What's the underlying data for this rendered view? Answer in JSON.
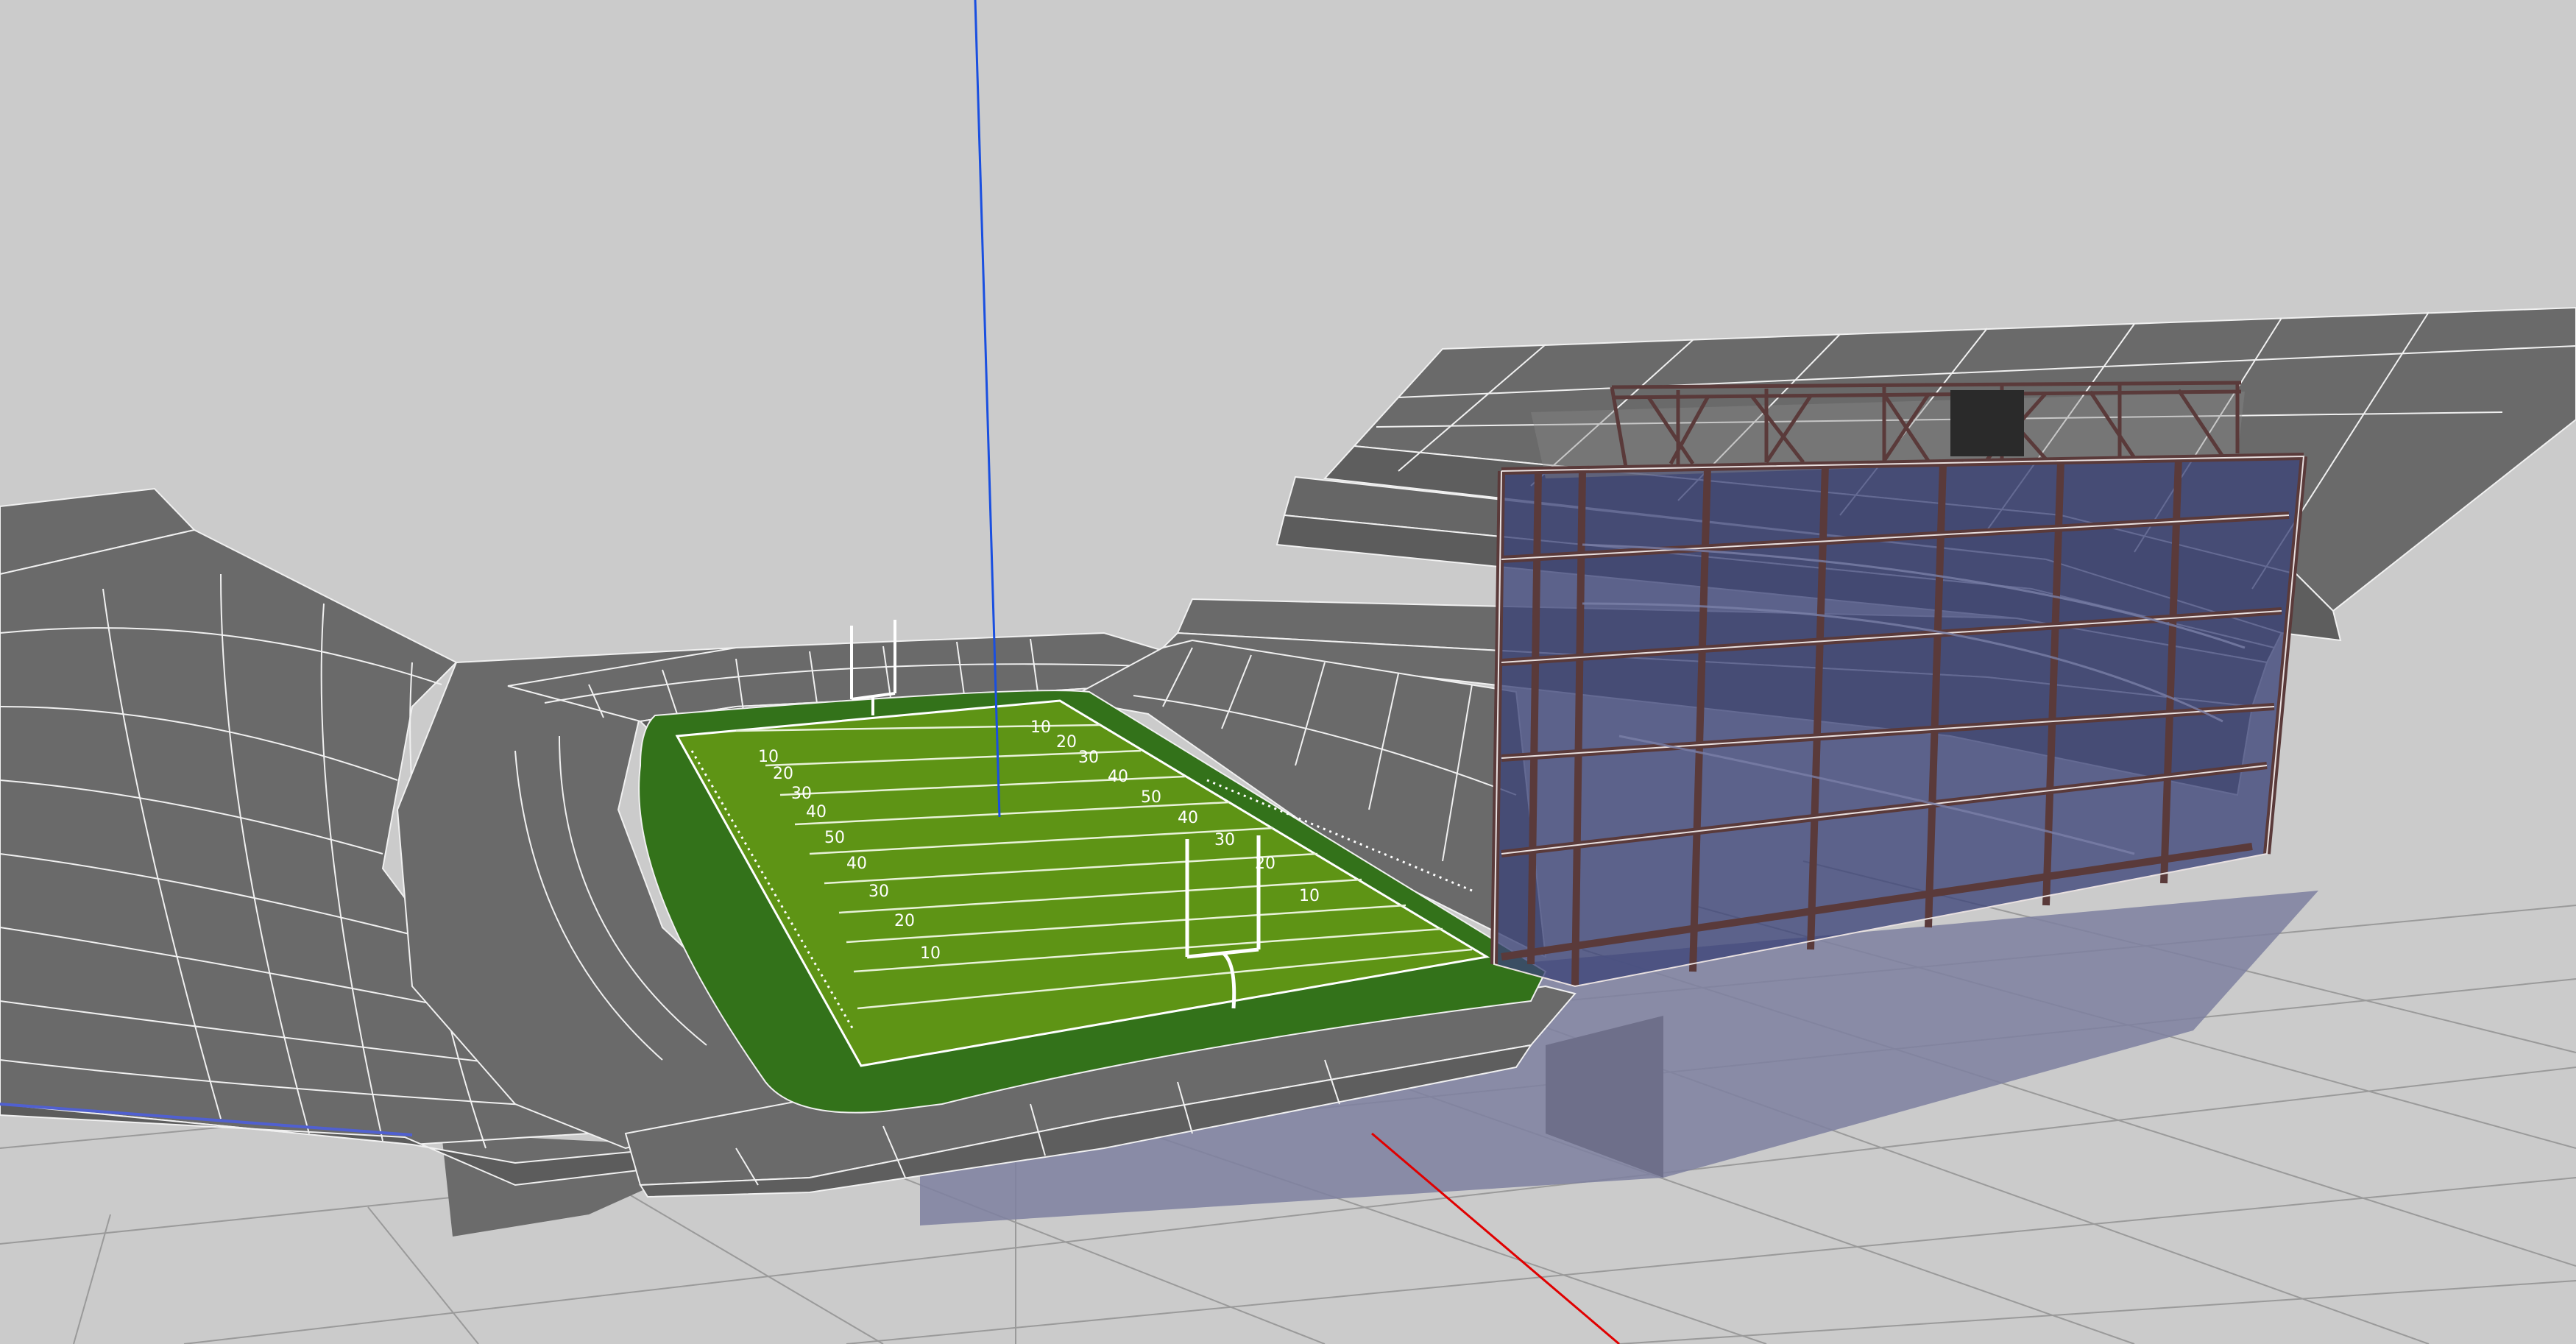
{
  "viewport": {
    "background": "#cbcbcb",
    "icon": "3d-model-viewport"
  },
  "colors": {
    "stands": "#6a6a6a",
    "stands_dark": "#5e5e5e",
    "wireline": "#f0f0f0",
    "field_border": "#33721a",
    "field_turf": "#5e9415",
    "glass": "#3c4478",
    "frame": "#5a3a3a",
    "axis_x": "#e00000",
    "axis_z": "#1a4fe0",
    "grid": "#9a9a9a"
  },
  "field": {
    "near_numbers": [
      "10",
      "20",
      "30",
      "40",
      "50",
      "40",
      "30",
      "20",
      "10"
    ],
    "far_numbers": [
      "10",
      "20",
      "30",
      "40",
      "50",
      "40",
      "30",
      "20",
      "10"
    ]
  }
}
